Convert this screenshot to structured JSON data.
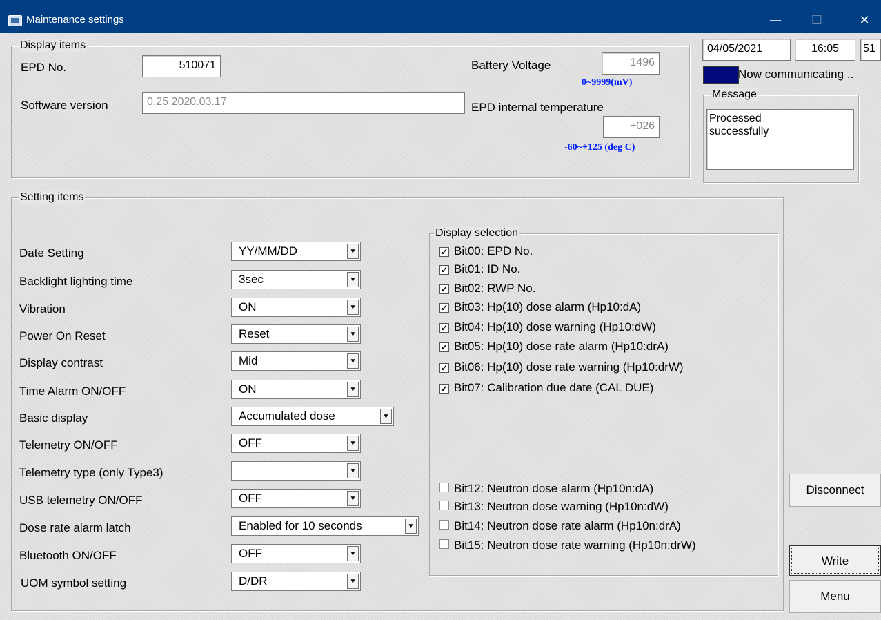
{
  "window": {
    "title": "Maintenance settings",
    "minimize": "—",
    "maximize": "☐",
    "close": "✕"
  },
  "header": {
    "date": "04/05/2021",
    "time": "16:05",
    "seconds": "51",
    "status": "Now communicating ..",
    "status_color": "#000a7a"
  },
  "message": {
    "label": "Message",
    "text_line1": "Processed",
    "text_line2": "successfully"
  },
  "display_items": {
    "label": "Display items",
    "epd_no_label": "EPD No.",
    "epd_no": "510071",
    "software_label": "Software version",
    "software_version": "0.25 2020.03.17",
    "battery_label": "Battery Voltage",
    "battery_value": "1496",
    "battery_range": "0~9999(mV)",
    "temp_label": "EPD internal temperature",
    "temp_value": "+026",
    "temp_range": "-60~+125 (deg C)"
  },
  "setting_items": {
    "label": "Setting items",
    "rows": [
      {
        "label": "Date Setting",
        "value": "YY/MM/DD"
      },
      {
        "label": "Backlight lighting time",
        "value": "3sec"
      },
      {
        "label": "Vibration",
        "value": "ON"
      },
      {
        "label": "Power On Reset",
        "value": "Reset"
      },
      {
        "label": "Display contrast",
        "value": "Mid"
      },
      {
        "label": "Time Alarm ON/OFF",
        "value": "ON"
      },
      {
        "label": "Basic display",
        "value": "Accumulated dose"
      },
      {
        "label": "Telemetry ON/OFF",
        "value": "OFF"
      },
      {
        "label": "Telemetry type (only Type3)",
        "value": ""
      },
      {
        "label": "USB telemetry ON/OFF",
        "value": "OFF"
      },
      {
        "label": "Dose rate alarm latch",
        "value": "Enabled for 10 seconds"
      },
      {
        "label": "Bluetooth ON/OFF",
        "value": "OFF"
      },
      {
        "label": "UOM symbol setting",
        "value": "D/DR"
      }
    ]
  },
  "display_selection": {
    "label": "Display selection",
    "bits": [
      {
        "label": "Bit00: EPD No.",
        "checked": true
      },
      {
        "label": "Bit01: ID No.",
        "checked": true
      },
      {
        "label": "Bit02: RWP No.",
        "checked": true
      },
      {
        "label": "Bit03: Hp(10) dose alarm (Hp10:dA)",
        "checked": true
      },
      {
        "label": "Bit04: Hp(10) dose warning (Hp10:dW)",
        "checked": true
      },
      {
        "label": "Bit05: Hp(10) dose rate alarm (Hp10:drA)",
        "checked": true
      },
      {
        "label": "Bit06: Hp(10) dose rate warning (Hp10:drW)",
        "checked": true
      },
      {
        "label": "Bit07: Calibration due date (CAL DUE)",
        "checked": true
      },
      {
        "label": "Bit12: Neutron dose alarm (Hp10n:dA)",
        "checked": false
      },
      {
        "label": "Bit13: Neutron dose warning (Hp10n:dW)",
        "checked": false
      },
      {
        "label": "Bit14: Neutron dose rate alarm (Hp10n:drA)",
        "checked": false
      },
      {
        "label": "Bit15: Neutron dose rate warning (Hp10n:drW)",
        "checked": false
      }
    ]
  },
  "buttons": {
    "disconnect": "Disconnect",
    "write": "Write",
    "menu": "Menu"
  }
}
